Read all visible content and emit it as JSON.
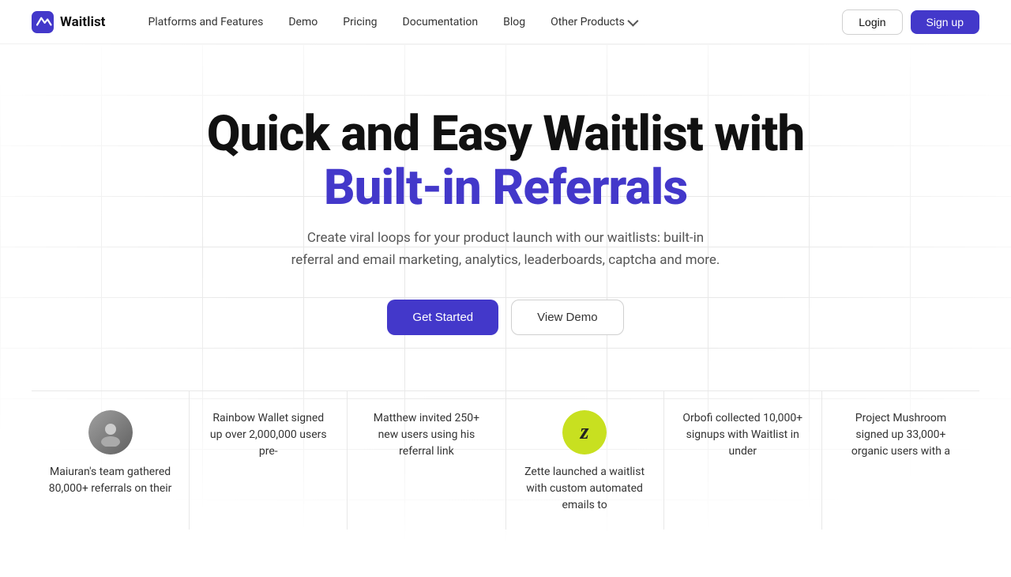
{
  "nav": {
    "logo_text": "Waitlist",
    "links": [
      {
        "label": "Platforms and Features",
        "has_dropdown": false
      },
      {
        "label": "Demo",
        "has_dropdown": false
      },
      {
        "label": "Pricing",
        "has_dropdown": false
      },
      {
        "label": "Documentation",
        "has_dropdown": false
      },
      {
        "label": "Blog",
        "has_dropdown": false
      },
      {
        "label": "Other Products",
        "has_dropdown": true
      }
    ],
    "login_label": "Login",
    "signup_label": "Sign up"
  },
  "hero": {
    "title_line1": "Quick and Easy Waitlist with",
    "title_line2": "Built-in Referrals",
    "subtitle": "Create viral loops for your product launch with our waitlists: built-in referral and email marketing, analytics, leaderboards, captcha and more.",
    "cta_primary": "Get Started",
    "cta_secondary": "View Demo"
  },
  "cards": [
    {
      "id": "card-1",
      "has_avatar": true,
      "avatar_type": "person",
      "text": "Maiuran's team gathered 80,000+ referrals on their"
    },
    {
      "id": "card-2",
      "has_avatar": false,
      "avatar_type": "none",
      "text": "Rainbow Wallet signed up over 2,000,000 users pre-"
    },
    {
      "id": "card-3",
      "has_avatar": false,
      "avatar_type": "none",
      "text": "Matthew invited 250+ new users using his referral link"
    },
    {
      "id": "card-4",
      "has_avatar": true,
      "avatar_type": "zette",
      "text": "Zette launched a waitlist with custom automated emails to"
    },
    {
      "id": "card-5",
      "has_avatar": false,
      "avatar_type": "none",
      "text": "Orbofi collected 10,000+ signups with Waitlist in under"
    },
    {
      "id": "card-6",
      "has_avatar": false,
      "avatar_type": "none",
      "text": "Project Mushroom signed up 33,000+ organic users with a"
    }
  ]
}
